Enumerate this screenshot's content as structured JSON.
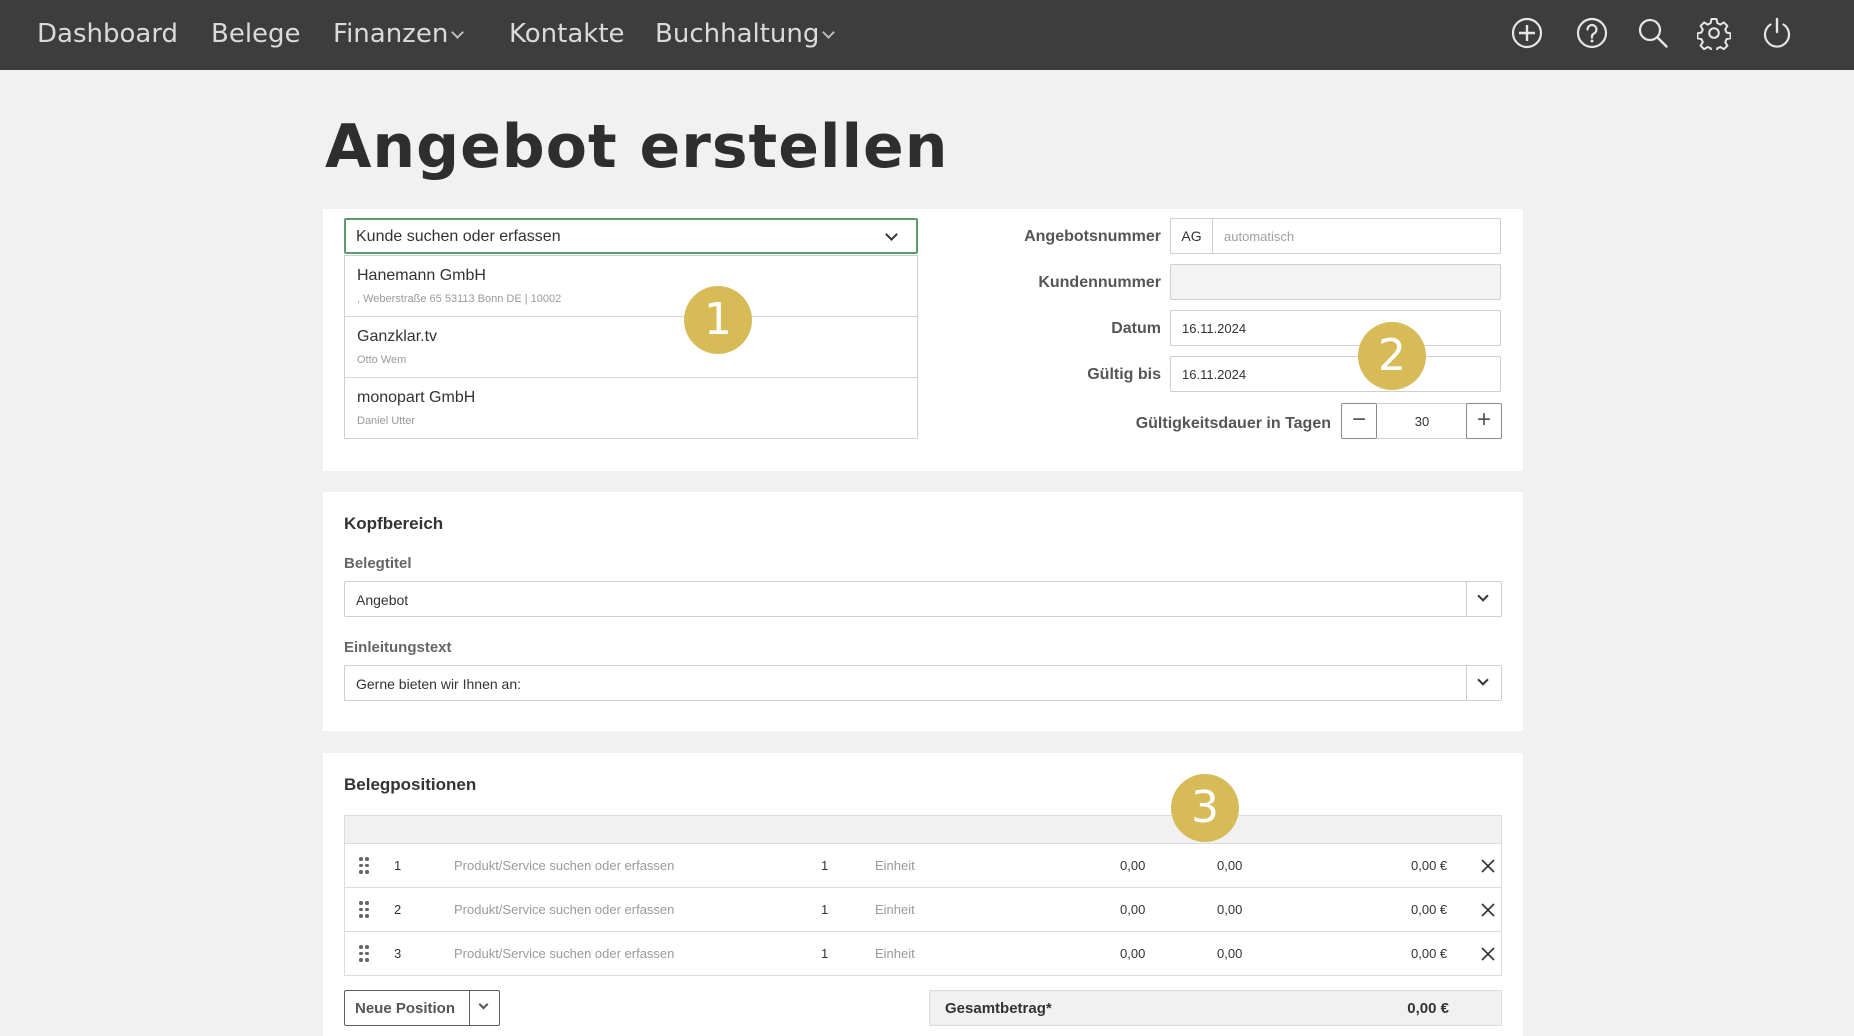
{
  "nav": {
    "items": [
      {
        "label": "Dashboard",
        "has_menu": false
      },
      {
        "label": "Belege",
        "has_menu": false
      },
      {
        "label": "Finanzen",
        "has_menu": true
      },
      {
        "label": "Kontakte",
        "has_menu": false
      },
      {
        "label": "Buchhaltung",
        "has_menu": true
      }
    ],
    "icons": [
      "plus-circle-icon",
      "help-circle-icon",
      "search-icon",
      "gear-icon",
      "power-icon"
    ]
  },
  "page": {
    "title": "Angebot erstellen"
  },
  "customer": {
    "placeholder": "Kunde suchen oder erfassen",
    "results": [
      {
        "name": "Hanemann GmbH",
        "sub": ", Weberstraße 65 53113 Bonn DE | 10002"
      },
      {
        "name": "Ganzklar.tv",
        "sub": "Otto Wem"
      },
      {
        "name": "monopart GmbH",
        "sub": "Daniel Utter"
      }
    ]
  },
  "meta": {
    "offer_number_label": "Angebotsnummer",
    "offer_number_prefix": "AG",
    "offer_number_placeholder": "automatisch",
    "customer_number_label": "Kundennummer",
    "customer_number_value": "",
    "date_label": "Datum",
    "date_value": "16.11.2024",
    "valid_until_label": "Gültig bis",
    "valid_until_value": "16.11.2024",
    "validity_label": "Gültigkeitsdauer in Tagen",
    "validity_days": "30"
  },
  "header_section": {
    "title": "Kopfbereich",
    "doc_title_label": "Belegtitel",
    "doc_title_value": "Angebot",
    "intro_label": "Einleitungstext",
    "intro_value": "Gerne bieten wir Ihnen an:"
  },
  "positions": {
    "title": "Belegpositionen",
    "rows": [
      {
        "num": "1",
        "product": "Produkt/Service suchen oder erfassen",
        "qty": "1",
        "unit": "Einheit",
        "price": "0,00",
        "discount": "0,00",
        "total": "0,00 €"
      },
      {
        "num": "2",
        "product": "Produkt/Service suchen oder erfassen",
        "qty": "1",
        "unit": "Einheit",
        "price": "0,00",
        "discount": "0,00",
        "total": "0,00 €"
      },
      {
        "num": "3",
        "product": "Produkt/Service suchen oder erfassen",
        "qty": "1",
        "unit": "Einheit",
        "price": "0,00",
        "discount": "0,00",
        "total": "0,00 €"
      }
    ],
    "new_position_label": "Neue Position",
    "total_label": "Gesamtbetrag*",
    "total_value": "0,00 €"
  },
  "callouts": [
    "1",
    "2",
    "3"
  ],
  "colors": {
    "nav_bg": "#3d3d3d",
    "accent_green": "#5d9a6e",
    "callout": "#d7bb56"
  }
}
